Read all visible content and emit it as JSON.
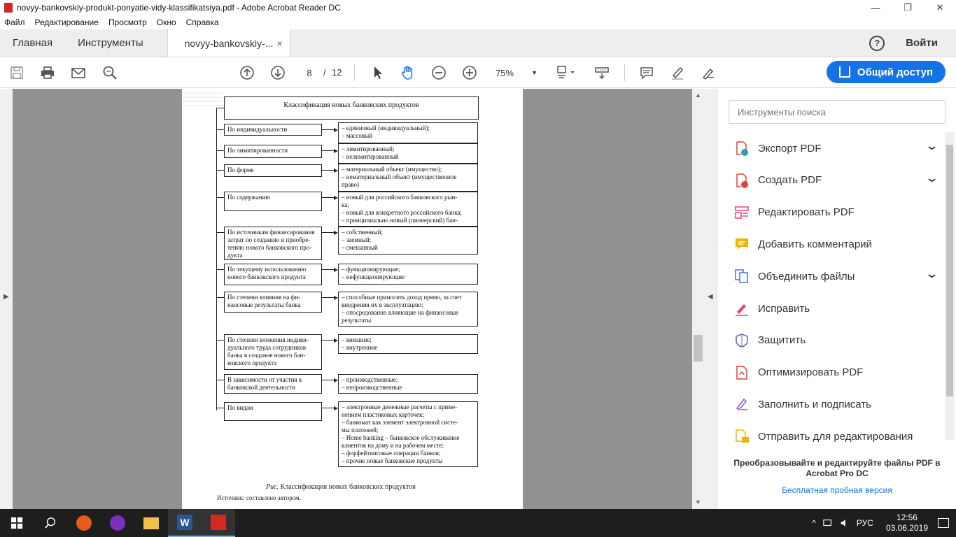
{
  "window": {
    "title": "novyy-bankovskiy-produkt-ponyatie-vidy-klassifikatsiya.pdf - Adobe Acrobat Reader DC",
    "minimize": "—",
    "maximize": "❐",
    "close": "✕"
  },
  "menu": [
    "Файл",
    "Редактирование",
    "Просмотр",
    "Окно",
    "Справка"
  ],
  "tabs": {
    "home": "Главная",
    "tools": "Инструменты",
    "document": "novyy-bankovskiy-...",
    "close": "×",
    "help": "?",
    "signin": "Войти"
  },
  "toolbar": {
    "page_current": "8",
    "page_sep": "/",
    "page_total": "12",
    "zoom": "75%",
    "share": "Общий доступ"
  },
  "pdf": {
    "title": "Классификация новых банковских продуктов",
    "rows": [
      {
        "left": [
          "По индивидуальности"
        ],
        "right": [
          "– единичный (индивидуальный);",
          "– массовый"
        ]
      },
      {
        "left": [
          "По лимитированности"
        ],
        "right": [
          "– лимитированный;",
          "– нелимитированный"
        ]
      },
      {
        "left": [
          "По форме"
        ],
        "right": [
          "– материальный объект (имущество);",
          "– нематериальный объект (имущественное",
          "право)"
        ]
      },
      {
        "left": [
          "По содержанию"
        ],
        "right": [
          "– новый для российского банковского рын-",
          "ка;",
          "– новый для конкретного российского банка;",
          "– принципиально новый (пионерский) бан-"
        ]
      },
      {
        "left": [
          "По источникам финансирования",
          "затрат по созданию и приобре-",
          "тению нового банковского про-",
          "дукта"
        ],
        "right": [
          "– собственный;",
          "– заемный;",
          "– смешанный"
        ]
      },
      {
        "left": [
          "По текущему использованию",
          "нового банковского продукта"
        ],
        "right": [
          "– функционирующие;",
          "– нефункционирующие"
        ]
      },
      {
        "left": [
          "По степени влияния на фи-",
          "нансовые результаты банка"
        ],
        "right": [
          "– способные приносить доход прямо, за счет",
          "внедрения их в эксплуатацию;",
          "– опосредованно влияющие на финансовые",
          "результаты"
        ]
      },
      {
        "left": [
          "По степени вложения индиви-",
          "дуального труда сотрудников",
          "банка в создание нового бан-",
          "ковского продукта"
        ],
        "right": [
          "– внешние;",
          "– внутренние"
        ]
      },
      {
        "left": [
          "В зависимости от участия в",
          "банковской деятельности"
        ],
        "right": [
          "– производственные;",
          "– непроизводственные"
        ]
      },
      {
        "left": [
          "По видам"
        ],
        "right": [
          "– электронные денежные расчеты с приме-",
          "нением пластиковых карточек;",
          "– банкомат как элемент электронной систе-",
          "мы платежей;",
          "– Home banking – банковское обслуживание",
          "клиентов на дому и на рабочем месте;",
          "– форфейтинговые операции банков;",
          "– прочие новые банковские продукты"
        ]
      }
    ],
    "caption_prefix": "Рис.",
    "caption": " Классификация новых банковских продуктов",
    "source": "Источник: составлено автором."
  },
  "panel": {
    "search_placeholder": "Инструменты поиска",
    "tools": [
      {
        "label": "Экспорт PDF",
        "icon": "export-pdf-icon",
        "color": "#2ba3a3",
        "chevron": true
      },
      {
        "label": "Создать PDF",
        "icon": "create-pdf-icon",
        "color": "#e0413d",
        "chevron": true
      },
      {
        "label": "Редактировать PDF",
        "icon": "edit-pdf-icon",
        "color": "#e0447c",
        "chevron": false
      },
      {
        "label": "Добавить комментарий",
        "icon": "comment-icon",
        "color": "#f0b400",
        "chevron": false
      },
      {
        "label": "Объединить файлы",
        "icon": "combine-files-icon",
        "color": "#4b6fd8",
        "chevron": true
      },
      {
        "label": "Исправить",
        "icon": "fix-icon",
        "color": "#e0447c",
        "chevron": false
      },
      {
        "label": "Защитить",
        "icon": "protect-icon",
        "color": "#5b6fc8",
        "chevron": false
      },
      {
        "label": "Оптимизировать PDF",
        "icon": "optimize-pdf-icon",
        "color": "#e0413d",
        "chevron": false
      },
      {
        "label": "Заполнить и подписать",
        "icon": "fill-sign-icon",
        "color": "#8a4fd0",
        "chevron": false
      },
      {
        "label": "Отправить для редактирования",
        "icon": "send-review-icon",
        "color": "#f0b400",
        "chevron": false
      }
    ],
    "promo": "Преобразовывайте и редактируйте файлы PDF в Acrobat Pro DC",
    "trial": "Бесплатная пробная версия"
  },
  "taskbar": {
    "lang": "РУС",
    "time": "12:56",
    "date": "03.06.2019"
  }
}
